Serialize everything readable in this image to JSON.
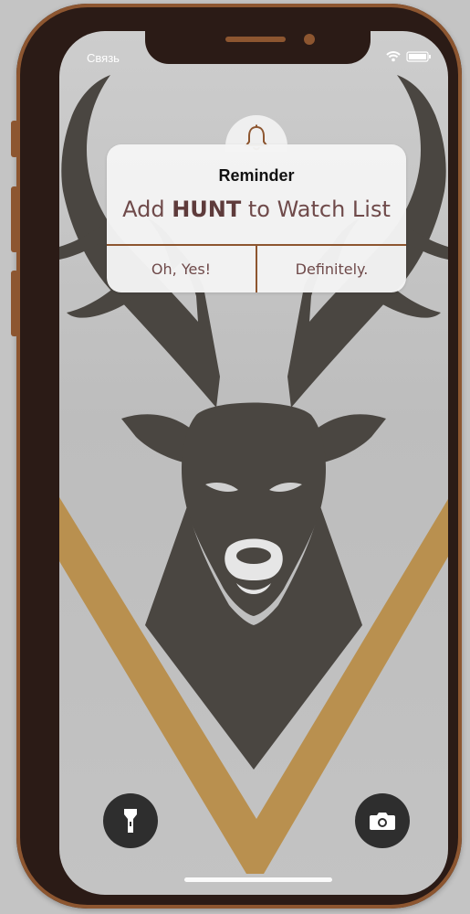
{
  "status_bar": {
    "carrier": "Связь",
    "icons": [
      "wifi-icon",
      "battery-icon"
    ]
  },
  "notification": {
    "icon": "bell-icon",
    "title": "Reminder",
    "message_prefix": "Add ",
    "message_highlight": "HUNT",
    "message_suffix": " to Watch List",
    "buttons": {
      "left": "Oh, Yes!",
      "right": "Definitely."
    }
  },
  "quick_actions": {
    "left_icon": "flashlight-icon",
    "right_icon": "camera-icon"
  },
  "colors": {
    "frame": "#2b1b16",
    "accent": "#8d5630",
    "text": "#6f4a4a",
    "deer": "#4a4641",
    "gold": "#b9904f"
  }
}
